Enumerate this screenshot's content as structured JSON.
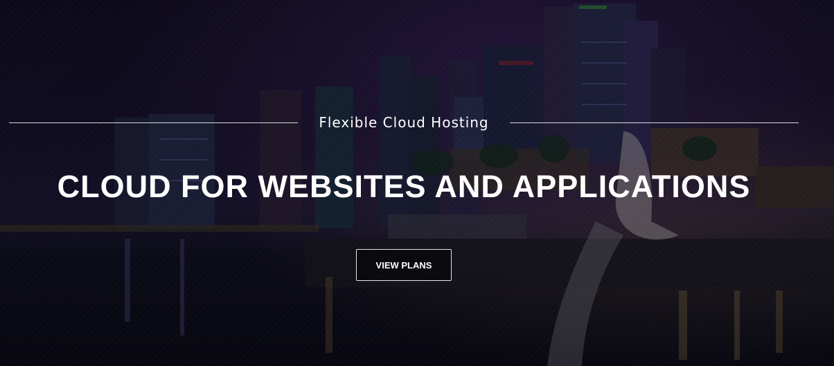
{
  "hero": {
    "subtitle": "Flexible Cloud Hosting",
    "headline": "CLOUD FOR WEBSITES AND APPLICATIONS",
    "cta_label": "VIEW PLANS"
  },
  "colors": {
    "text": "#ffffff",
    "overlay": "#0b0a14"
  }
}
